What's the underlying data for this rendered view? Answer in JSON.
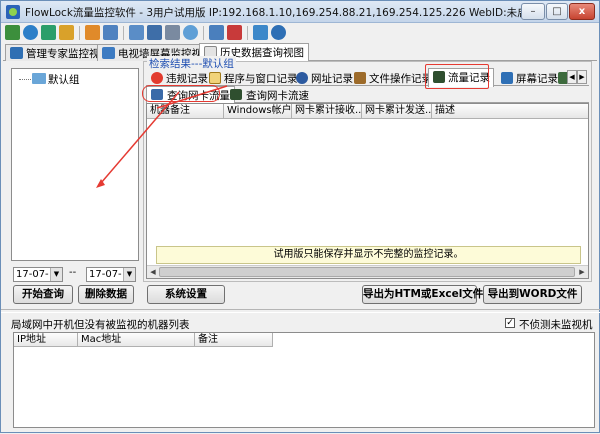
{
  "window": {
    "title": "FlowLock流量监控软件 - 3用户试用版 IP:192.168.1.10,169.254.88.21,169.254.125.226 WebID:未启用",
    "minimize": "–",
    "maximize": "□",
    "close": "x"
  },
  "toolbar": {
    "icons": [
      "db-icon",
      "globe-icon",
      "network-icon",
      "shield-icon",
      "tools-icon",
      "grid-icon",
      "monitor-icon",
      "monitor2-icon",
      "camera-icon",
      "record-icon",
      "notebook-icon",
      "flag-icon",
      "cart-icon",
      "help-icon"
    ]
  },
  "main_tabs": [
    {
      "label": "管理专家监控视图"
    },
    {
      "label": "电视墙屏幕监控视图"
    },
    {
      "label": "历史数据查询视图"
    }
  ],
  "tree": {
    "root": "默认组"
  },
  "dates": {
    "from": "17-07-",
    "sep": "--",
    "to": "17-07-"
  },
  "buttons": {
    "start_query": "开始查询",
    "delete_data": "删除数据",
    "system_settings": "系统设置",
    "export_htm_excel": "导出为HTM或Excel文件",
    "export_word": "导出到WORD文件"
  },
  "result_group": {
    "title": "检索结果---默认组"
  },
  "record_tabs": [
    {
      "label": "违规记录"
    },
    {
      "label": "程序与窗口记录"
    },
    {
      "label": "网址记录"
    },
    {
      "label": "文件操作记录"
    },
    {
      "label": "流量记录"
    },
    {
      "label": "屏幕记录"
    }
  ],
  "query_tabs": [
    {
      "label": "查询网卡流量"
    },
    {
      "label": "查询网卡流速"
    }
  ],
  "grid": {
    "columns": [
      "机器备注",
      "Windows帐户",
      "网卡累计接收...",
      "网卡累计发送...",
      "描述"
    ],
    "trial_notice": "试用版只能保存并显示不完整的监控记录。"
  },
  "lower": {
    "title": "局域网中开机但没有被监视的机器列表",
    "checkbox_label": "不侦测未监视机器",
    "checkbox_checked": "✓",
    "columns": [
      "IP地址",
      "Mac地址",
      "备注"
    ]
  }
}
